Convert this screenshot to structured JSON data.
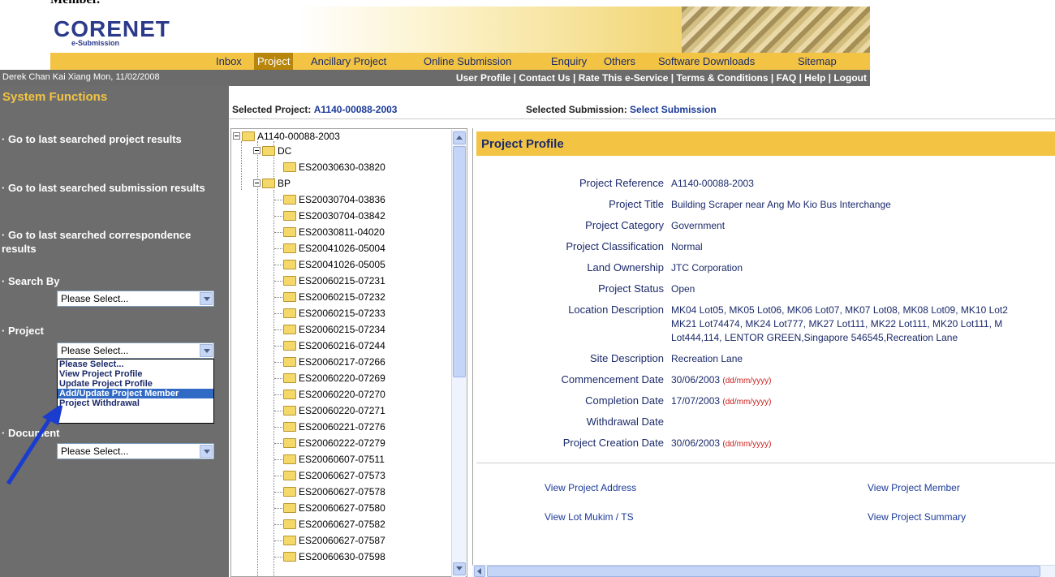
{
  "header": {
    "clipped_text": "Member.",
    "logo_main": "CORENET",
    "logo_sub": "e-Submission"
  },
  "nav": {
    "items": [
      "Inbox",
      "Project",
      "Ancillary Project",
      "Online Submission",
      "Enquiry",
      "Others",
      "Software Downloads",
      "Sitemap"
    ],
    "active": "Project"
  },
  "userbar": {
    "user": "Derek Chan Kai Xiang Mon, 11/02/2008",
    "links": [
      "User Profile",
      "Contact Us",
      "Rate This e-Service",
      "Terms & Conditions",
      "FAQ",
      "Help",
      "Logout"
    ]
  },
  "sidebar": {
    "title": "System Functions",
    "links": [
      "· Go to last searched project results",
      "· Go to last searched submission results",
      "· Go to last searched correspondence results"
    ],
    "search_by_label": "· Search By",
    "search_by_value": "Please Select...",
    "project_label": "· Project",
    "project_value": "Please Select...",
    "project_options": [
      "Please Select...",
      "View Project Profile",
      "Update Project Profile",
      "Add/Update Project Member",
      "Project Withdrawal"
    ],
    "project_selected_option": "Add/Update Project Member",
    "document_label": "· Document",
    "document_value": "Please Select..."
  },
  "selection": {
    "project_label": "Selected Project:",
    "project_value": "A1140-00088-2003",
    "submission_label": "Selected Submission:",
    "submission_value": "Select Submission"
  },
  "tree": {
    "root": "A1140-00088-2003",
    "dc": "DC",
    "dc_items": [
      "ES20030630-03820"
    ],
    "bp": "BP",
    "bp_items": [
      "ES20030704-03836",
      "ES20030704-03842",
      "ES20030811-04020",
      "ES20041026-05004",
      "ES20041026-05005",
      "ES20060215-07231",
      "ES20060215-07232",
      "ES20060215-07233",
      "ES20060215-07234",
      "ES20060216-07244",
      "ES20060217-07266",
      "ES20060220-07269",
      "ES20060220-07270",
      "ES20060220-07271",
      "ES20060221-07276",
      "ES20060222-07279",
      "ES20060607-07511",
      "ES20060627-07573",
      "ES20060627-07578",
      "ES20060627-07580",
      "ES20060627-07582",
      "ES20060627-07587",
      "ES20060630-07598"
    ]
  },
  "profile": {
    "title": "Project Profile",
    "fields": [
      {
        "label": "Project Reference",
        "value": "A1140-00088-2003"
      },
      {
        "label": "Project Title",
        "value": "Building Scraper near Ang Mo Kio Bus Interchange"
      },
      {
        "label": "Project Category",
        "value": "Government"
      },
      {
        "label": "Project Classification",
        "value": "Normal"
      },
      {
        "label": "Land Ownership",
        "value": "JTC Corporation"
      },
      {
        "label": "Project Status",
        "value": "Open"
      },
      {
        "label": "Location Description",
        "value": "MK04 Lot05, MK05 Lot06, MK06 Lot07, MK07 Lot08, MK08 Lot09, MK10 Lot2",
        "value2": "MK21 Lot74474, MK24 Lot777, MK27 Lot111, MK22 Lot111, MK20 Lot111, M",
        "value3": "Lot444,114, LENTOR GREEN,Singapore 546545,Recreation Lane"
      },
      {
        "label": "Site Description",
        "value": "Recreation Lane"
      },
      {
        "label": "Commencement Date",
        "value": "30/06/2003",
        "fmt": "(dd/mm/yyyy)"
      },
      {
        "label": "Completion Date",
        "value": "17/07/2003",
        "fmt": "(dd/mm/yyyy)"
      },
      {
        "label": "Withdrawal Date",
        "value": ""
      },
      {
        "label": "Project Creation Date",
        "value": "30/06/2003",
        "fmt": "(dd/mm/yyyy)"
      }
    ],
    "links": {
      "address": "View Project Address",
      "member": "View Project Member",
      "lot": "View Lot Mukim / TS",
      "summary": "View Project Summary"
    }
  },
  "colors": {
    "accent_yellow": "#f3c443",
    "sidebar_gray": "#6d6d6d",
    "link_blue": "#1b3a9a",
    "highlight": "#316ac5",
    "arrow_blue": "#1a3ccf"
  }
}
